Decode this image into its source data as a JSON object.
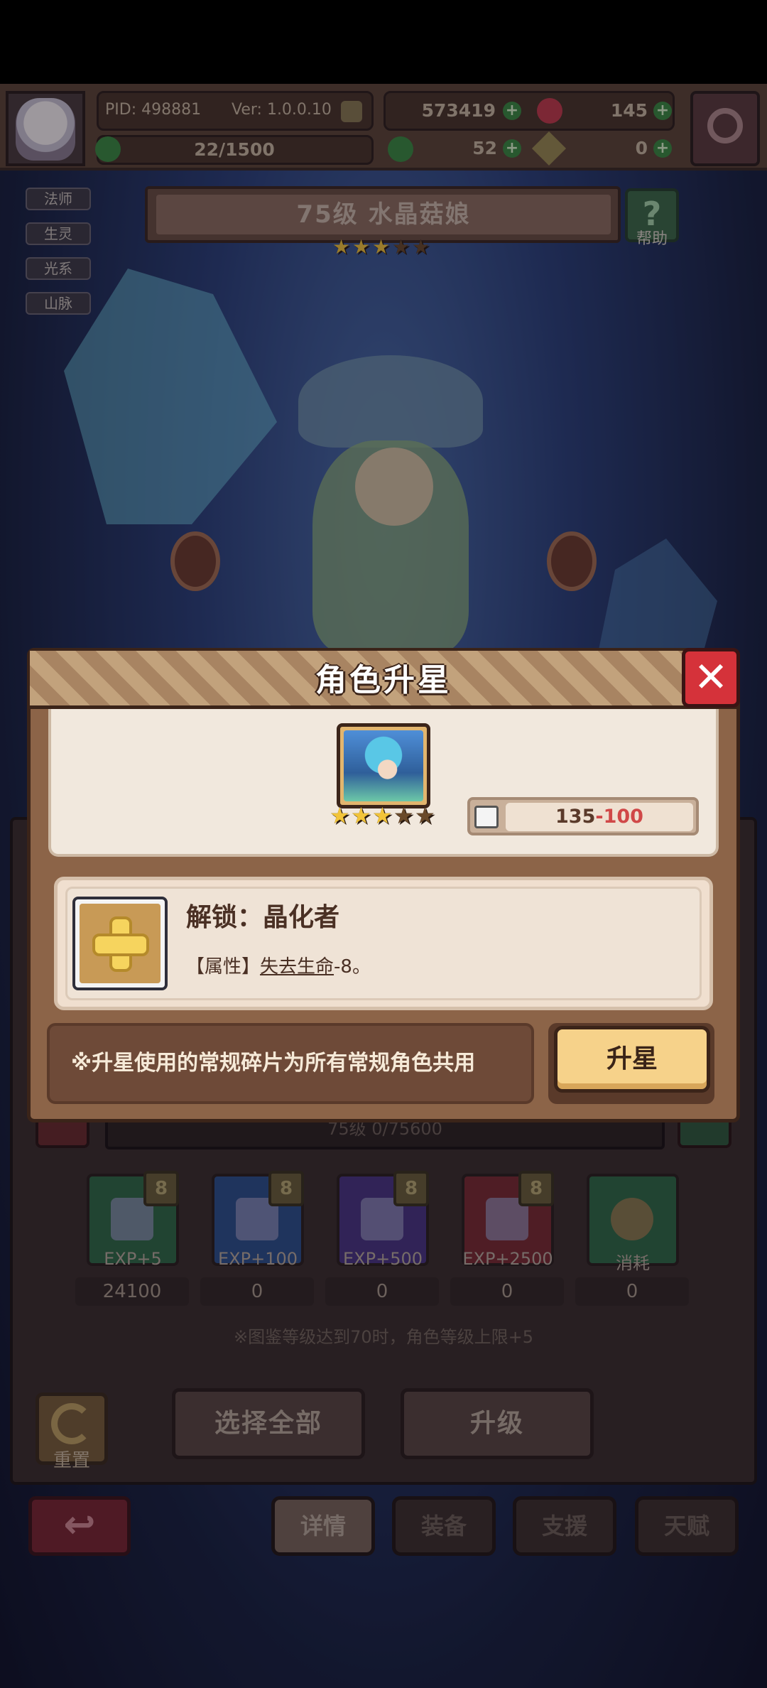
{
  "hud": {
    "pid": "PID: 498881",
    "version": "Ver: 1.0.0.10",
    "gold": "573419",
    "gems": "145",
    "stamina": "22/1500",
    "clover": "52",
    "keys": "0",
    "settings_icon": "gear-icon"
  },
  "tags": [
    "法师",
    "生灵",
    "光系",
    "山脉"
  ],
  "character": {
    "name_banner": "75级 水晶菇娘",
    "stars_filled": 3,
    "stars_total": 5,
    "help_label": "帮助"
  },
  "modal": {
    "title": "角色升星",
    "close_icon": "close-icon",
    "portrait_stars_filled": 3,
    "portrait_stars_total": 5,
    "shard_current": "135",
    "shard_separator": "-",
    "shard_required": "100",
    "unlock_title": "解锁：晶化者",
    "unlock_attr_prefix": "【属性】",
    "unlock_attr_link": "失去生命",
    "unlock_attr_suffix": "-8。",
    "tip": "※升星使用的常规碎片为所有常规角色共用",
    "upgrade_button": "升星"
  },
  "lower": {
    "exp_bar": "75级  0/75600",
    "items": [
      {
        "label": "EXP+5",
        "count": "24100",
        "badge": "8",
        "color": "#2f6a45"
      },
      {
        "label": "EXP+100",
        "count": "0",
        "badge": "8",
        "color": "#2c4f8a"
      },
      {
        "label": "EXP+500",
        "count": "0",
        "badge": "8",
        "color": "#4a3580"
      },
      {
        "label": "EXP+2500",
        "count": "0",
        "badge": "8",
        "color": "#7a2a30"
      },
      {
        "label": "消耗",
        "count": "0",
        "badge": "",
        "color": "#2f6a45"
      }
    ],
    "note": "※图鉴等级达到70时，角色等级上限+5",
    "select_all": "选择全部",
    "level_up": "升级",
    "reset": "重置"
  },
  "nav": {
    "back_icon": "back-arrow-icon",
    "tabs": [
      "详情",
      "装备",
      "支援",
      "天赋"
    ]
  },
  "colors": {
    "accent_gold": "#f6d28a",
    "close_red": "#d5323a",
    "shard_required_red": "#d04848"
  }
}
